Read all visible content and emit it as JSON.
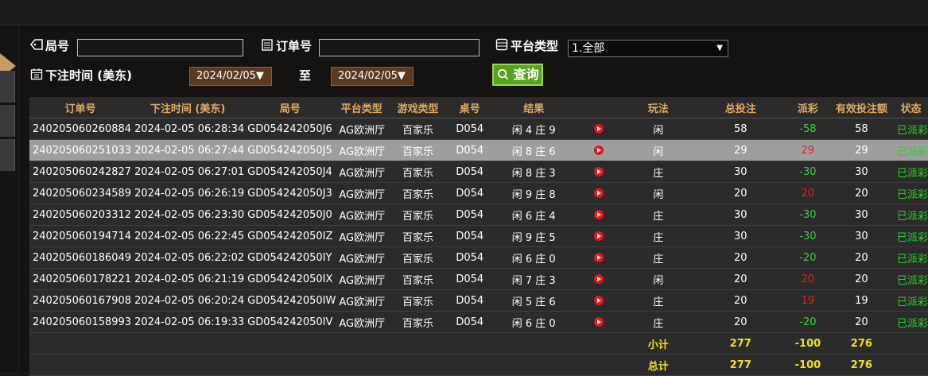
{
  "filters": {
    "round_label": "局号",
    "order_label": "订单号",
    "platform_label": "平台类型",
    "platform_value": "1.全部",
    "time_label": "下注时间 (美东)",
    "date_from": "2024/02/05▼",
    "to_label": "至",
    "date_to": "2024/02/05▼",
    "query_label": "查询",
    "query_icon": "search-icon"
  },
  "table": {
    "headers": [
      "订单号",
      "下注时间 (美东)",
      "局号",
      "平台类型",
      "游戏类型",
      "桌号",
      "结果",
      "",
      "玩法",
      "总投注",
      "派彩",
      "有效投注额",
      "状态"
    ],
    "rows": [
      {
        "order": "240205060260884",
        "time": "2024-02-05 06:28:34",
        "round": "GD054242050J6",
        "platform": "AG欧洲厅",
        "game": "百家乐",
        "table": "D054",
        "result": "闲 4 庄 9",
        "bet": "闲",
        "total": "58",
        "payout": "-58",
        "valid": "58",
        "status": "已派彩",
        "payout_color": "#3bd23b"
      },
      {
        "order": "240205060251033",
        "time": "2024-02-05 06:27:44",
        "round": "GD054242050J5",
        "platform": "AG欧洲厅",
        "game": "百家乐",
        "table": "D054",
        "result": "闲 8 庄 6",
        "bet": "闲",
        "total": "29",
        "payout": "29",
        "valid": "29",
        "status": "已派彩",
        "payout_color": "#e02020"
      },
      {
        "order": "240205060242827",
        "time": "2024-02-05 06:27:01",
        "round": "GD054242050J4",
        "platform": "AG欧洲厅",
        "game": "百家乐",
        "table": "D054",
        "result": "闲 8 庄 3",
        "bet": "庄",
        "total": "30",
        "payout": "-30",
        "valid": "30",
        "status": "已派彩",
        "payout_color": "#3bd23b"
      },
      {
        "order": "240205060234589",
        "time": "2024-02-05 06:26:19",
        "round": "GD054242050J3",
        "platform": "AG欧洲厅",
        "game": "百家乐",
        "table": "D054",
        "result": "闲 9 庄 8",
        "bet": "闲",
        "total": "20",
        "payout": "20",
        "valid": "20",
        "status": "已派彩",
        "payout_color": "#e02020"
      },
      {
        "order": "240205060203312",
        "time": "2024-02-05 06:23:30",
        "round": "GD054242050J0",
        "platform": "AG欧洲厅",
        "game": "百家乐",
        "table": "D054",
        "result": "闲 6 庄 4",
        "bet": "庄",
        "total": "30",
        "payout": "-30",
        "valid": "30",
        "status": "已派彩",
        "payout_color": "#3bd23b"
      },
      {
        "order": "240205060194714",
        "time": "2024-02-05 06:22:45",
        "round": "GD054242050IZ",
        "platform": "AG欧洲厅",
        "game": "百家乐",
        "table": "D054",
        "result": "闲 9 庄 5",
        "bet": "庄",
        "total": "30",
        "payout": "-30",
        "valid": "30",
        "status": "已派彩",
        "payout_color": "#3bd23b"
      },
      {
        "order": "240205060186049",
        "time": "2024-02-05 06:22:02",
        "round": "GD054242050IY",
        "platform": "AG欧洲厅",
        "game": "百家乐",
        "table": "D054",
        "result": "闲 6 庄 0",
        "bet": "庄",
        "total": "20",
        "payout": "-20",
        "valid": "20",
        "status": "已派彩",
        "payout_color": "#3bd23b"
      },
      {
        "order": "240205060178221",
        "time": "2024-02-05 06:21:19",
        "round": "GD054242050IX",
        "platform": "AG欧洲厅",
        "game": "百家乐",
        "table": "D054",
        "result": "闲 7 庄 3",
        "bet": "闲",
        "total": "20",
        "payout": "20",
        "valid": "20",
        "status": "已派彩",
        "payout_color": "#e02020"
      },
      {
        "order": "240205060167908",
        "time": "2024-02-05 06:20:24",
        "round": "GD054242050IW",
        "platform": "AG欧洲厅",
        "game": "百家乐",
        "table": "D054",
        "result": "闲 5 庄 6",
        "bet": "庄",
        "total": "20",
        "payout": "19",
        "valid": "19",
        "status": "已派彩",
        "payout_color": "#e02020"
      },
      {
        "order": "240205060158993",
        "time": "2024-02-05 06:19:33",
        "round": "GD054242050IV",
        "platform": "AG欧洲厅",
        "game": "百家乐",
        "table": "D054",
        "result": "闲 6 庄 0",
        "bet": "庄",
        "total": "20",
        "payout": "-20",
        "valid": "20",
        "status": "已派彩",
        "payout_color": "#3bd23b"
      }
    ],
    "highlight_row": 1,
    "subtotal": {
      "label": "小计",
      "total": "277",
      "payout": "-100",
      "valid": "276"
    },
    "grand_total": {
      "label": "总计",
      "total": "277",
      "payout": "-100",
      "valid": "276"
    }
  }
}
